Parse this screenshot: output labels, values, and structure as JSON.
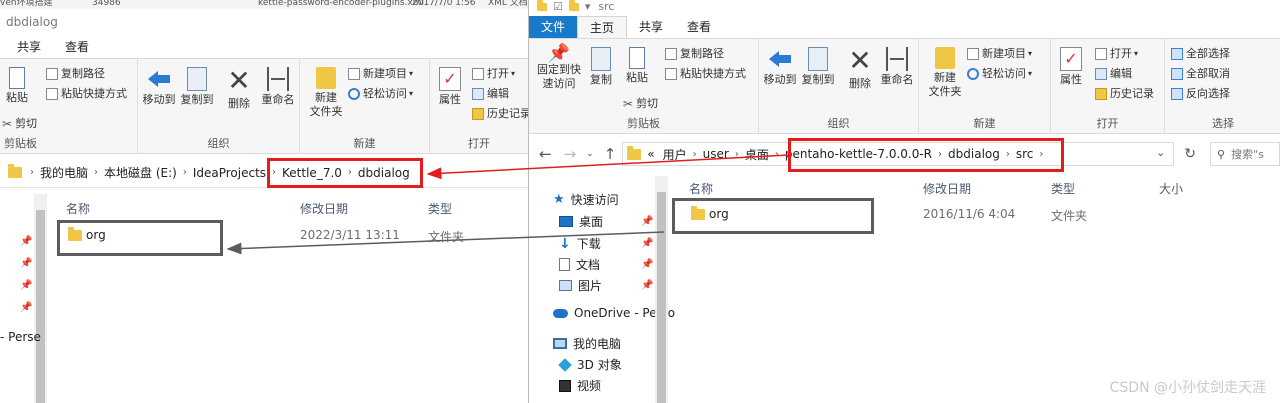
{
  "background_window": {
    "strip_title": "ven环境搭建",
    "strip_views": "34986",
    "strip_file": "kettle-password-encoder-plugins.xml",
    "strip_date": "2017/7/0 1:56",
    "strip_type": "XML 文档"
  },
  "left_window": {
    "title": "dbdialog",
    "tabs": [
      "共享",
      "查看"
    ],
    "ribbon": {
      "paste": "粘贴",
      "copy_path": "复制路径",
      "paste_shortcut": "粘贴快捷方式",
      "cut": "剪切",
      "clipboard_label": "剪贴板",
      "move_to": "移动到",
      "copy_to": "复制到",
      "delete": "删除",
      "rename": "重命名",
      "organize_label": "组织",
      "new_item": "新建项目",
      "easy_access": "轻松访问",
      "new_folder": "新建\n文件夹",
      "new_label": "新建",
      "properties": "属性",
      "open": "打开",
      "edit": "编辑",
      "history": "历史记录",
      "open_label": "打开"
    },
    "address": [
      "我的电脑",
      "本地磁盘 (E:)",
      "IdeaProjects",
      "Kettle_7.0",
      "dbdialog"
    ],
    "columns": {
      "name": "名称",
      "date": "修改日期",
      "type": "类型"
    },
    "rows": [
      {
        "name": "org",
        "date": "2022/3/11 13:11",
        "type": "文件夹"
      }
    ],
    "sidebar_stub": "- Perse"
  },
  "right_window": {
    "title": "src",
    "tabs": [
      "文件",
      "主页",
      "共享",
      "查看"
    ],
    "ribbon": {
      "pin_quick": "固定到快\n速访问",
      "copy": "复制",
      "paste": "粘贴",
      "copy_path": "复制路径",
      "paste_shortcut": "粘贴快捷方式",
      "cut": "剪切",
      "clipboard_label": "剪贴板",
      "move_to": "移动到",
      "copy_to": "复制到",
      "delete": "删除",
      "rename": "重命名",
      "organize_label": "组织",
      "new_item": "新建项目",
      "easy_access": "轻松访问",
      "new_folder": "新建\n文件夹",
      "new_label": "新建",
      "properties": "属性",
      "open": "打开",
      "edit": "编辑",
      "history": "历史记录",
      "open_label": "打开",
      "select_all": "全部选择",
      "select_none": "全部取消",
      "invert": "反向选择",
      "select_label": "选择"
    },
    "address": [
      "«",
      "用户",
      "user",
      "桌面",
      "pentaho-kettle-7.0.0.0-R",
      "dbdialog",
      "src"
    ],
    "search_placeholder": "搜索\"s",
    "columns": {
      "name": "名称",
      "date": "修改日期",
      "type": "类型",
      "size": "大小"
    },
    "rows": [
      {
        "name": "org",
        "date": "2016/11/6 4:04",
        "type": "文件夹"
      }
    ],
    "nav": [
      "快速访问",
      "桌面",
      "下载",
      "文档",
      "图片",
      "OneDrive - Perso",
      "我的电脑",
      "3D 对象",
      "视频"
    ]
  },
  "watermark": "CSDN @小孙仗剑走天涯",
  "colors": {
    "highlight_box": "#e31d1d",
    "annotation_box": "#5c5c5c",
    "file_tab": "#1979ca"
  }
}
